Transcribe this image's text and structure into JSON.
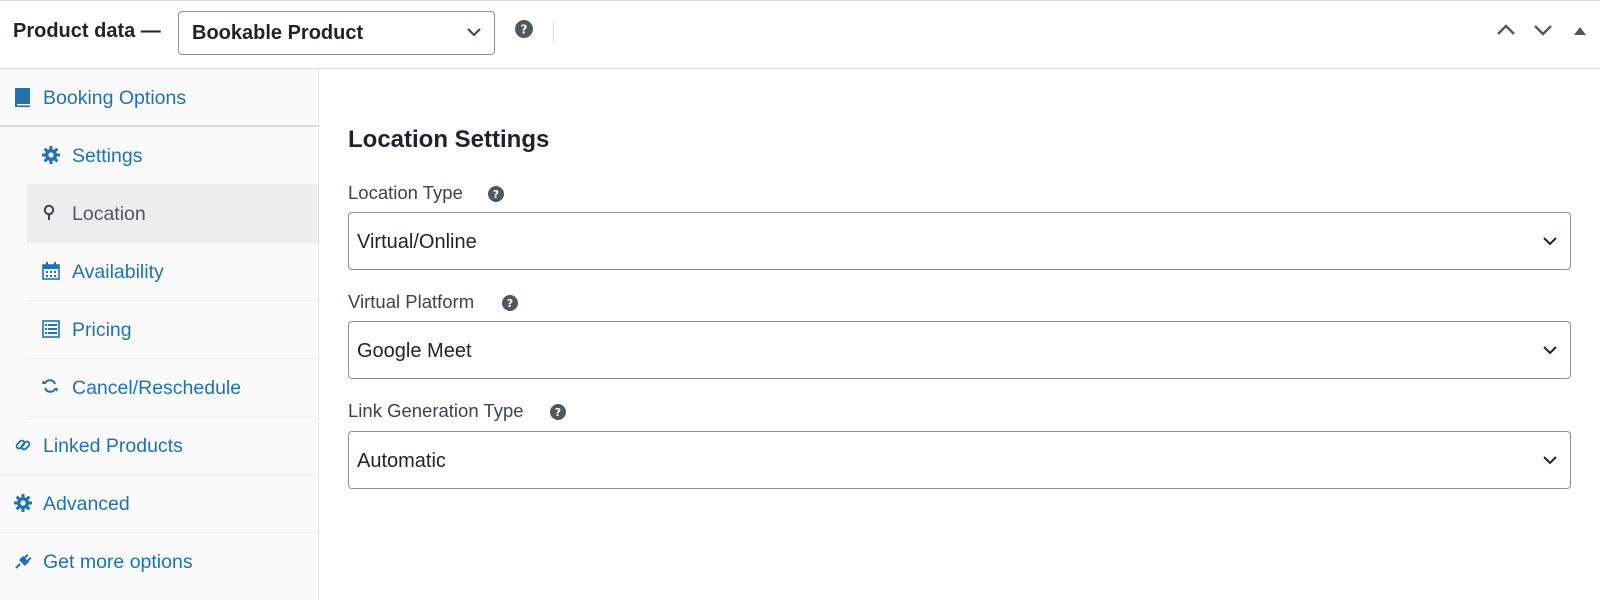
{
  "header": {
    "title": "Product data —",
    "product_type": "Bookable Product"
  },
  "sidebar": {
    "items": [
      {
        "label": "Booking Options",
        "icon": "book-icon"
      },
      {
        "label": "Settings",
        "icon": "gear-icon"
      },
      {
        "label": "Location",
        "icon": "location-pin-icon"
      },
      {
        "label": "Availability",
        "icon": "calendar-icon"
      },
      {
        "label": "Pricing",
        "icon": "list-icon"
      },
      {
        "label": "Cancel/Reschedule",
        "icon": "refresh-icon"
      },
      {
        "label": "Linked Products",
        "icon": "link-icon"
      },
      {
        "label": "Advanced",
        "icon": "gear-icon"
      },
      {
        "label": "Get more options",
        "icon": "plugin-icon"
      }
    ],
    "active": "Location"
  },
  "main": {
    "section_title": "Location Settings",
    "fields": [
      {
        "label": "Location Type",
        "value": "Virtual/Online"
      },
      {
        "label": "Virtual Platform",
        "value": "Google Meet"
      },
      {
        "label": "Link Generation Type",
        "value": "Automatic"
      }
    ]
  },
  "colors": {
    "link": "#2271b1",
    "active_bg": "#eeeeee",
    "sidebar_bg": "#fafafa",
    "text": "#1d2327",
    "help_icon": "#50575e"
  }
}
